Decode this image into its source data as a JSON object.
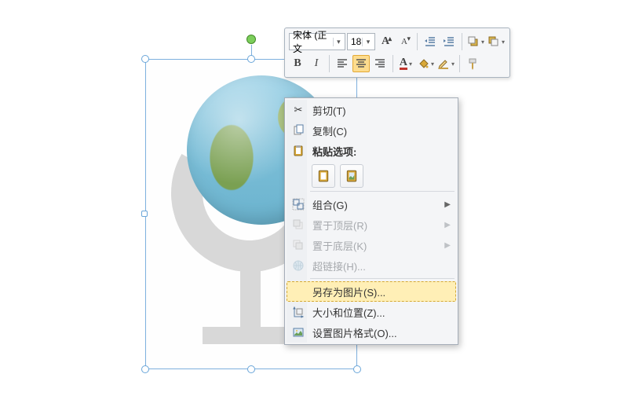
{
  "toolbar": {
    "font_name": "宋体 (正文",
    "font_size": "18",
    "buttons": {
      "grow_font": "A",
      "shrink_font": "A",
      "bold": "B",
      "italic": "I"
    }
  },
  "context_menu": {
    "cut": "剪切(T)",
    "copy": "复制(C)",
    "paste_header": "粘贴选项:",
    "group": "组合(G)",
    "bring_front": "置于顶层(R)",
    "send_back": "置于底层(K)",
    "hyperlink": "超链接(H)...",
    "save_as_picture": "另存为图片(S)...",
    "size_position": "大小和位置(Z)...",
    "format_picture": "设置图片格式(O)..."
  },
  "colors": {
    "accent": "#fddc8e",
    "font_color": "#c0342c",
    "highlight": "#ffe79b"
  }
}
